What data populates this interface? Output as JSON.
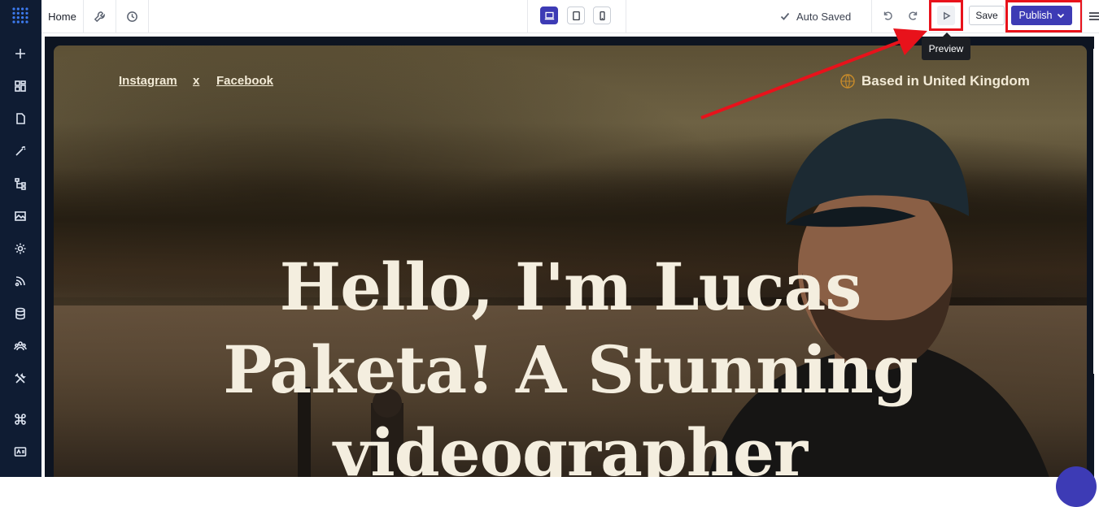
{
  "topbar": {
    "home_label": "Home",
    "autosave_label": "Auto Saved",
    "save_label": "Save",
    "publish_label": "Publish",
    "tooltip": "Preview"
  },
  "sidebar": {
    "items": [
      {
        "icon": "plus-icon"
      },
      {
        "icon": "grid-icon"
      },
      {
        "icon": "page-icon"
      },
      {
        "icon": "magic-wand-icon"
      },
      {
        "icon": "sitemap-icon"
      },
      {
        "icon": "image-icon"
      },
      {
        "icon": "settings-icon"
      },
      {
        "icon": "broadcast-icon"
      },
      {
        "icon": "database-icon"
      },
      {
        "icon": "team-icon"
      },
      {
        "icon": "tools-icon"
      },
      {
        "icon": "command-icon"
      },
      {
        "icon": "id-card-icon"
      }
    ]
  },
  "hero": {
    "link_instagram": "Instagram",
    "link_sep": "x",
    "link_facebook": "Facebook",
    "location": "Based in United Kingdom",
    "title": "Hello, I'm Lucas Paketa! A Stunning videographer"
  },
  "colors": {
    "accent": "#3d3bb5",
    "sidebar_bg": "#0f1c33",
    "highlight": "#e8121b"
  }
}
